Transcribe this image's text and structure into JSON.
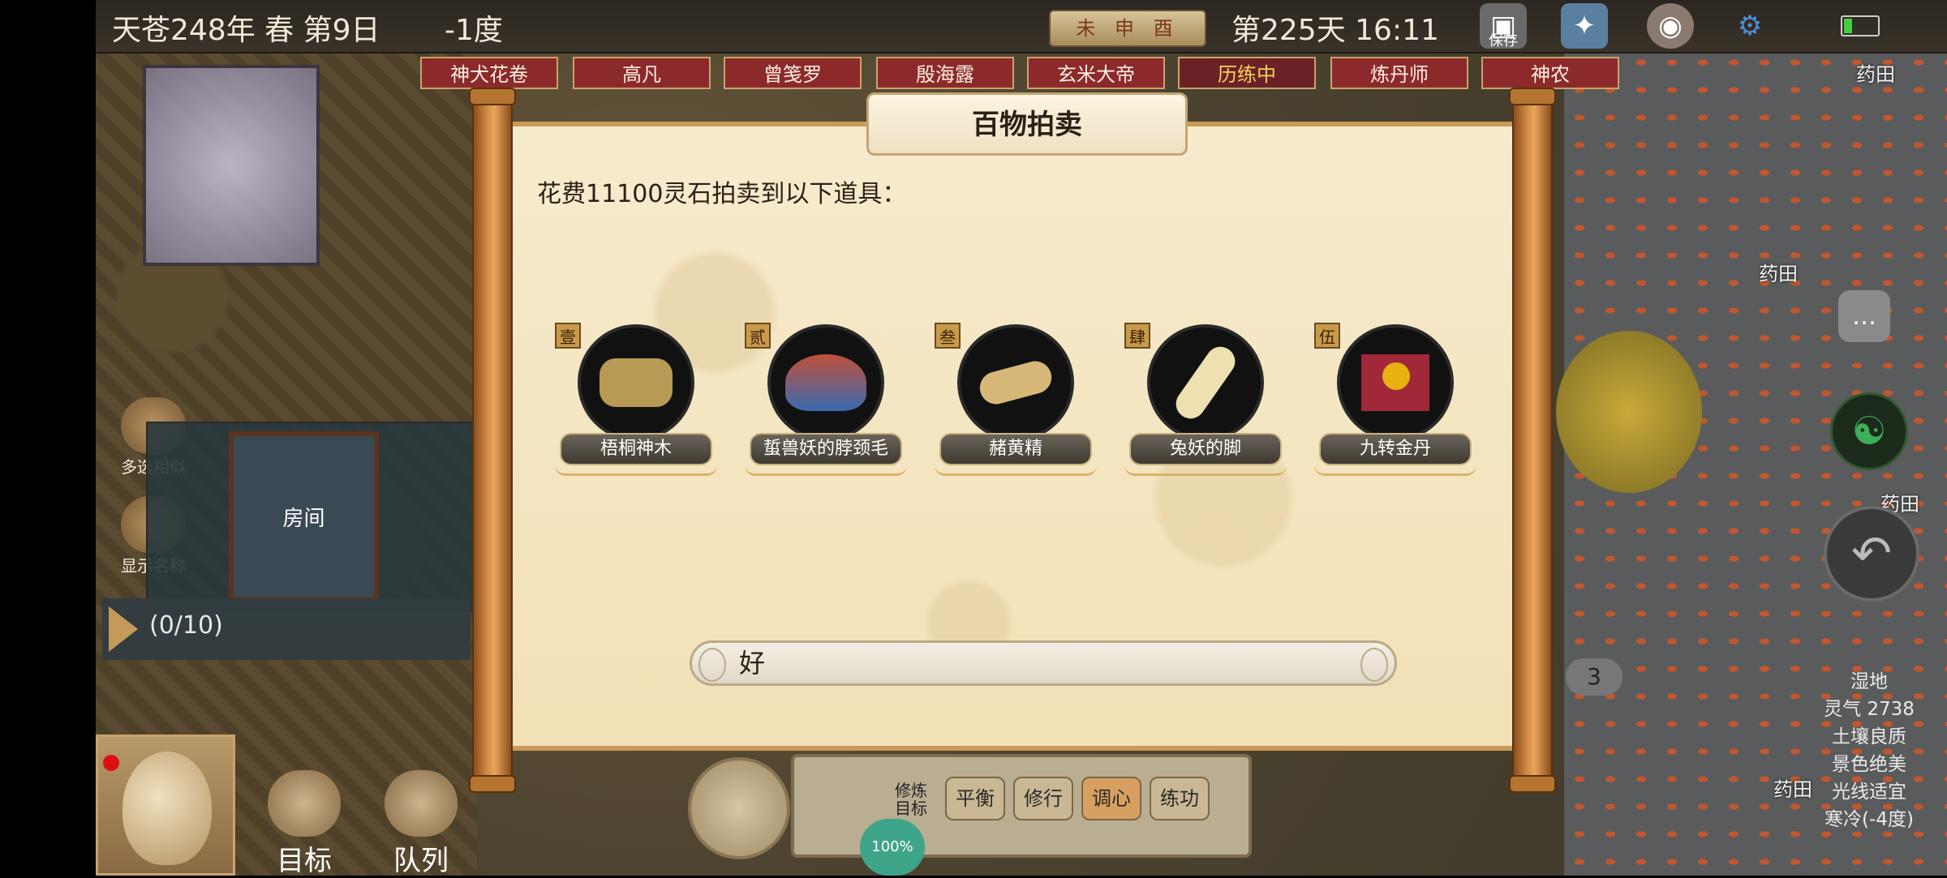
{
  "topbar": {
    "date": "天苍248年 春 第9日",
    "temp": "-1度",
    "hours_badge": "未 申 酉",
    "day_time": "第225天 16:11",
    "save_label": "保存"
  },
  "tags": [
    {
      "label": "神犬花卷",
      "active": false
    },
    {
      "label": "高凡",
      "active": false
    },
    {
      "label": "曾笺罗",
      "active": false
    },
    {
      "label": "殷海露",
      "active": false
    },
    {
      "label": "玄米大帝",
      "active": false
    },
    {
      "label": "历练中",
      "active": true
    },
    {
      "label": "炼丹师",
      "active": false
    },
    {
      "label": "神农",
      "active": false
    }
  ],
  "left_tools": {
    "multi_select": "多选相似",
    "show_names": "显示名称"
  },
  "room_label": "房间",
  "queue_count": "(0/10)",
  "bottom_buttons": {
    "target": "目标",
    "team": "队列"
  },
  "hud": {
    "label": "修炼目标",
    "options": [
      "平衡",
      "修行",
      "调心",
      "练功"
    ],
    "selected": "调心",
    "percent": "100%"
  },
  "map_labels": [
    "药田",
    "药田",
    "药田",
    "药田"
  ],
  "badge_number": "3",
  "tile_status": [
    "湿地",
    "灵气 2738",
    "土壤良质",
    "景色绝美",
    "光线适宜",
    "寒冷(-4度)"
  ],
  "dialog": {
    "title": "百物拍卖",
    "description": "花费11100灵石拍卖到以下道具：",
    "items": [
      {
        "index": "壹",
        "name": "梧桐神木",
        "icon": "wood-bundle-icon",
        "color": "#b89a55"
      },
      {
        "index": "贰",
        "name": "蜇兽妖的脖颈毛",
        "icon": "fur-tuft-icon",
        "color": "#c0503a"
      },
      {
        "index": "叁",
        "name": "赭黄精",
        "icon": "root-icon",
        "color": "#d8b878"
      },
      {
        "index": "肆",
        "name": "兔妖的脚",
        "icon": "bone-foot-icon",
        "color": "#eee0b0"
      },
      {
        "index": "伍",
        "name": "九转金丹",
        "icon": "golden-pill-icon",
        "color": "#e8b010"
      }
    ],
    "confirm_label": "好"
  }
}
